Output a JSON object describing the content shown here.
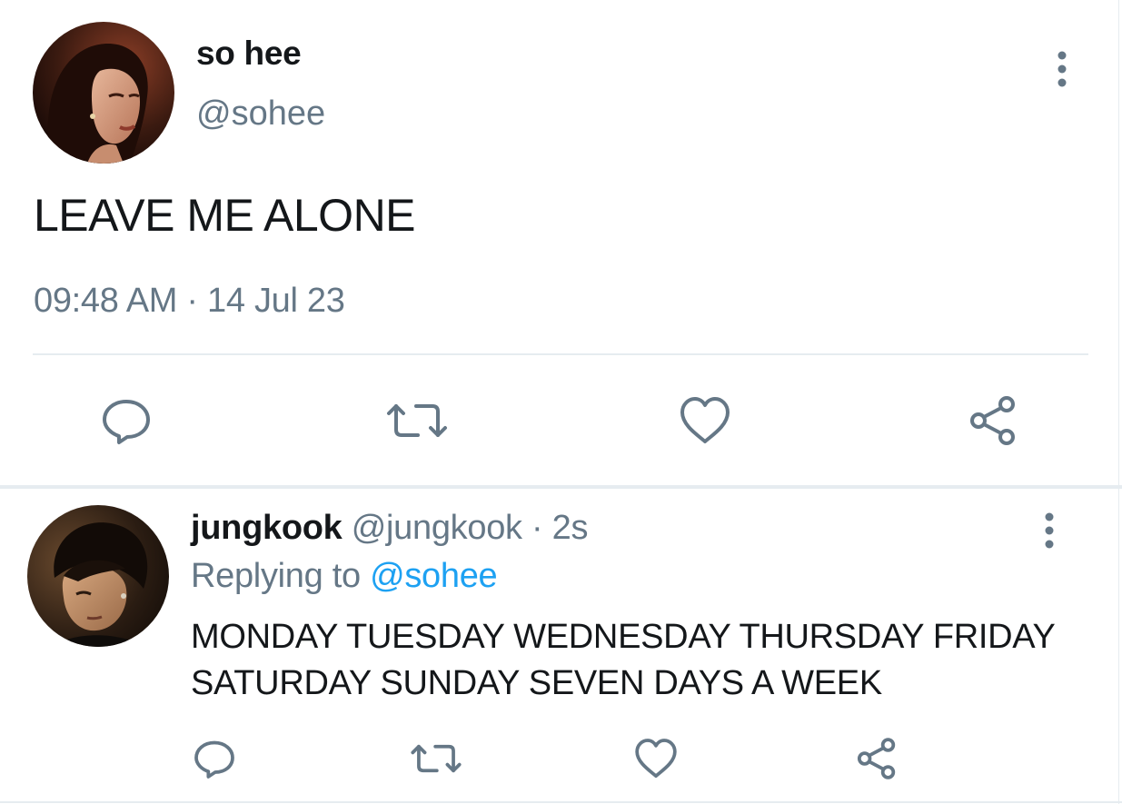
{
  "main_tweet": {
    "display_name": "so hee",
    "handle": "@sohee",
    "text": "LEAVE ME ALONE",
    "timestamp": "09:48 AM · 14 Jul 23",
    "avatar_icon": "profile-photo-woman",
    "actions": [
      "reply-icon",
      "retweet-icon",
      "like-icon",
      "share-icon"
    ]
  },
  "reply_tweet": {
    "display_name": "jungkook",
    "handle": "@jungkook",
    "separator": "·",
    "time": "2s",
    "replying_prefix": "Replying to ",
    "replying_to": "@sohee",
    "text": "MONDAY TUESDAY WEDNESDAY THURSDAY FRIDAY SATURDAY SUNDAY SEVEN DAYS A WEEK",
    "avatar_icon": "profile-photo-man",
    "actions": [
      "reply-icon",
      "retweet-icon",
      "like-icon",
      "share-icon"
    ]
  },
  "colors": {
    "text_primary": "#14171a",
    "text_secondary": "#657786",
    "link": "#1da1f2",
    "divider": "#e6ecf0",
    "icon": "#657786"
  }
}
